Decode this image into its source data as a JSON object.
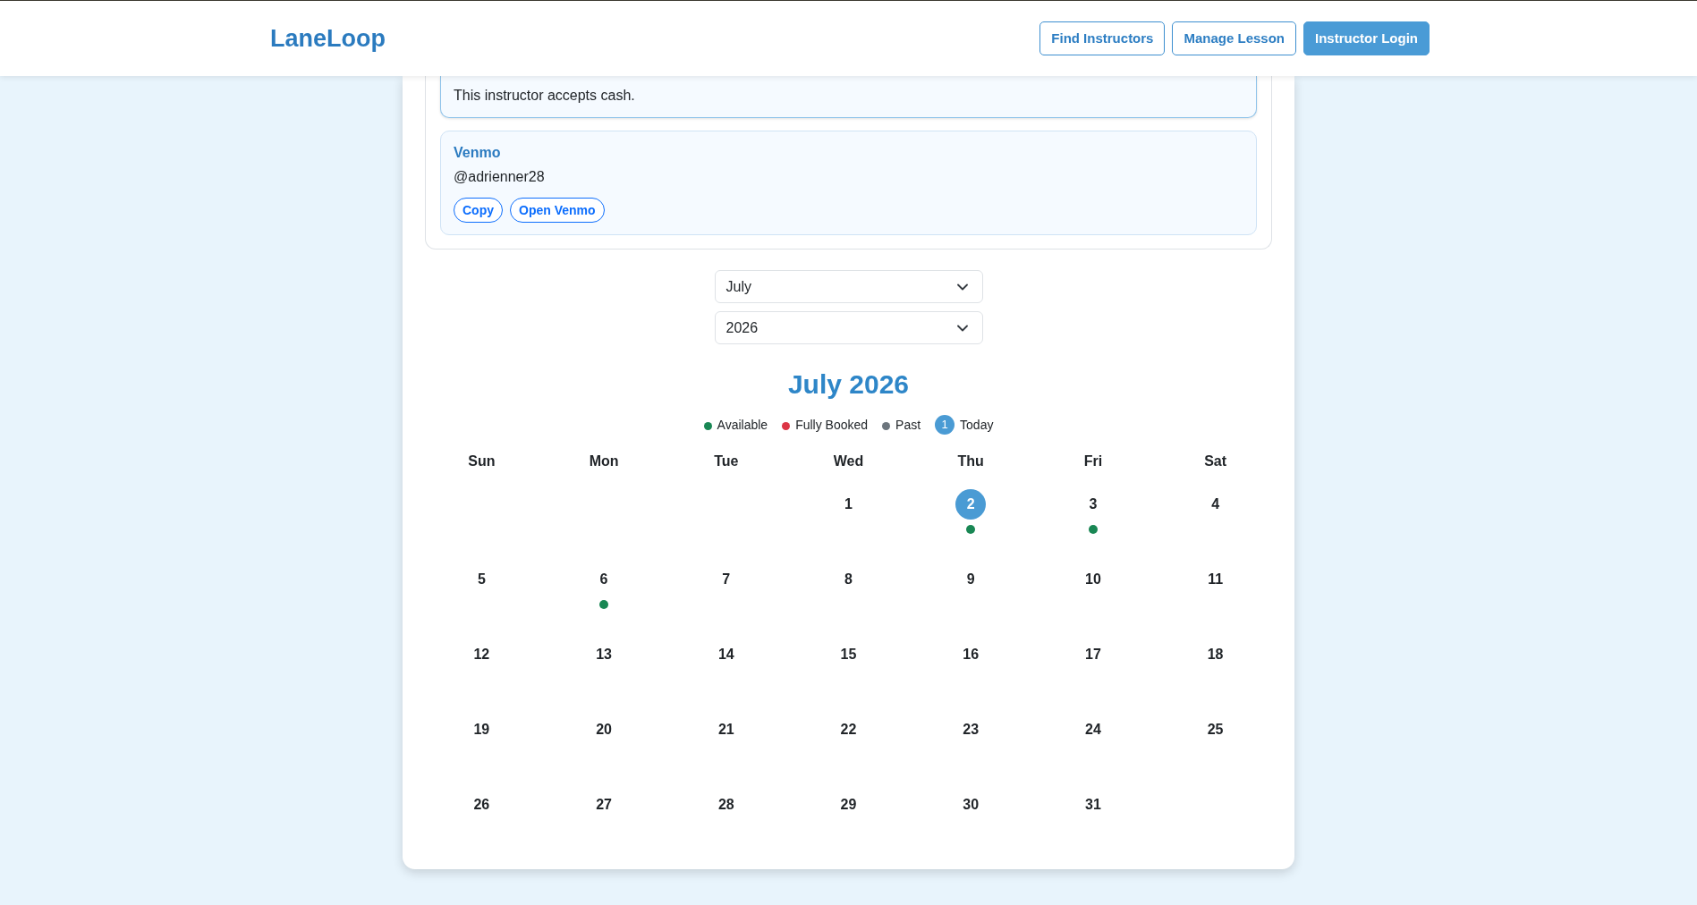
{
  "header": {
    "logo": "LaneLoop",
    "nav": [
      {
        "label": "Find Instructors",
        "kind": "outline"
      },
      {
        "label": "Manage Lesson",
        "kind": "outline"
      },
      {
        "label": "Instructor Login",
        "kind": "primary"
      }
    ]
  },
  "payment_methods": [
    {
      "selected": true,
      "lines": [
        "This instructor accepts cash."
      ]
    },
    {
      "selected": false,
      "name": "Venmo",
      "lines": [
        "@adrienner28"
      ],
      "actions": [
        "Copy",
        "Open Venmo"
      ]
    }
  ],
  "month_select": {
    "value": "July"
  },
  "year_select": {
    "value": "2026"
  },
  "calendar": {
    "title": "July 2026",
    "legend": [
      {
        "kind": "dot",
        "label": "Available",
        "color": "#198754"
      },
      {
        "kind": "dot",
        "label": "Fully Booked",
        "color": "#dc3545"
      },
      {
        "kind": "dot",
        "label": "Past",
        "color": "#6c757d"
      },
      {
        "kind": "today",
        "marker": "1",
        "label": "Today"
      }
    ],
    "weekdays": [
      "Sun",
      "Mon",
      "Tue",
      "Wed",
      "Thu",
      "Fri",
      "Sat"
    ],
    "weeks": [
      [
        {
          "kind": "empty"
        },
        {
          "kind": "empty"
        },
        {
          "kind": "empty"
        },
        {
          "kind": "day",
          "label": "1",
          "today": false,
          "available": false
        },
        {
          "kind": "day",
          "label": "2",
          "today": true,
          "available": true
        },
        {
          "kind": "day",
          "label": "3",
          "today": false,
          "available": true
        },
        {
          "kind": "day",
          "label": "4",
          "today": false,
          "available": false
        }
      ],
      [
        {
          "kind": "day",
          "label": "5",
          "today": false,
          "available": false
        },
        {
          "kind": "day",
          "label": "6",
          "today": false,
          "available": true
        },
        {
          "kind": "day",
          "label": "7",
          "today": false,
          "available": false
        },
        {
          "kind": "day",
          "label": "8",
          "today": false,
          "available": false
        },
        {
          "kind": "day",
          "label": "9",
          "today": false,
          "available": false
        },
        {
          "kind": "day",
          "label": "10",
          "today": false,
          "available": false
        },
        {
          "kind": "day",
          "label": "11",
          "today": false,
          "available": false
        }
      ],
      [
        {
          "kind": "day",
          "label": "12",
          "today": false,
          "available": false
        },
        {
          "kind": "day",
          "label": "13",
          "today": false,
          "available": false
        },
        {
          "kind": "day",
          "label": "14",
          "today": false,
          "available": false
        },
        {
          "kind": "day",
          "label": "15",
          "today": false,
          "available": false
        },
        {
          "kind": "day",
          "label": "16",
          "today": false,
          "available": false
        },
        {
          "kind": "day",
          "label": "17",
          "today": false,
          "available": false
        },
        {
          "kind": "day",
          "label": "18",
          "today": false,
          "available": false
        }
      ],
      [
        {
          "kind": "day",
          "label": "19",
          "today": false,
          "available": false
        },
        {
          "kind": "day",
          "label": "20",
          "today": false,
          "available": false
        },
        {
          "kind": "day",
          "label": "21",
          "today": false,
          "available": false
        },
        {
          "kind": "day",
          "label": "22",
          "today": false,
          "available": false
        },
        {
          "kind": "day",
          "label": "23",
          "today": false,
          "available": false
        },
        {
          "kind": "day",
          "label": "24",
          "today": false,
          "available": false
        },
        {
          "kind": "day",
          "label": "25",
          "today": false,
          "available": false
        }
      ],
      [
        {
          "kind": "day",
          "label": "26",
          "today": false,
          "available": false
        },
        {
          "kind": "day",
          "label": "27",
          "today": false,
          "available": false
        },
        {
          "kind": "day",
          "label": "28",
          "today": false,
          "available": false
        },
        {
          "kind": "day",
          "label": "29",
          "today": false,
          "available": false
        },
        {
          "kind": "day",
          "label": "30",
          "today": false,
          "available": false
        },
        {
          "kind": "day",
          "label": "31",
          "today": false,
          "available": false
        },
        {
          "kind": "empty"
        }
      ]
    ]
  }
}
